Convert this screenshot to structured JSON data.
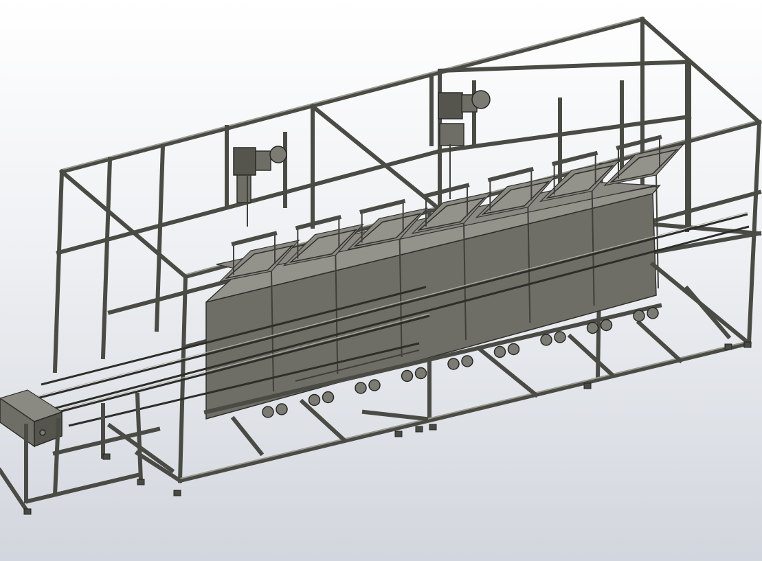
{
  "view": {
    "background_top": "#ffffff",
    "background_bottom": "#d2d6dd",
    "model_color": "#6e6e66",
    "edge_color": "#2f2f2b"
  },
  "model": {
    "tank_count": 7,
    "hoist_count": 2
  }
}
